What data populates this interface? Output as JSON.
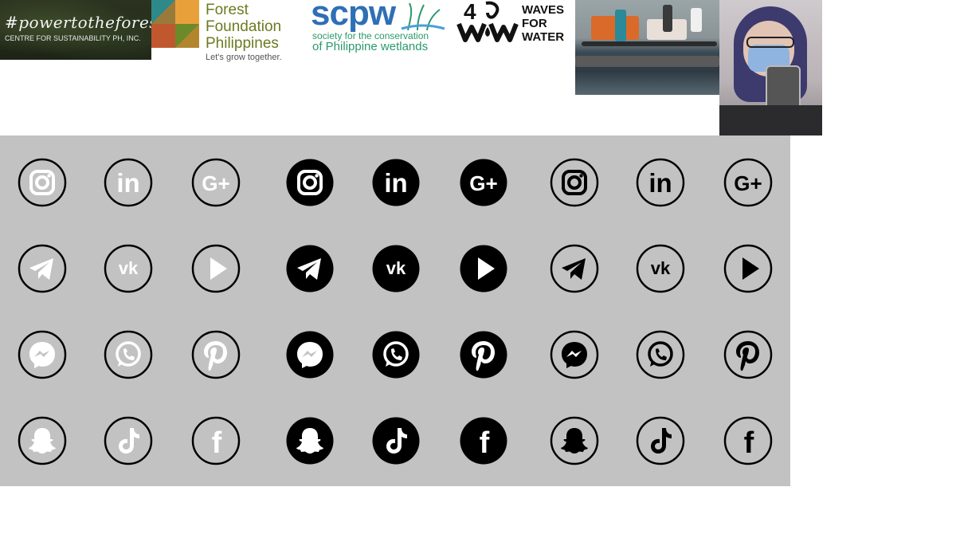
{
  "logos": {
    "cfs": {
      "tagline": "#powertotheforest",
      "org": "CENTRE FOR SUSTAINABILITY PH, INC."
    },
    "ffp": {
      "name_line1": "Forest",
      "name_line2": "Foundation",
      "name_line3": "Philippines",
      "slogan": "Let's grow together."
    },
    "scpw": {
      "abbr": "scpw",
      "line1": "society for the conservation",
      "line2": "of Philippine wetlands"
    },
    "wfw": {
      "mark": "4",
      "word1": "WAVES",
      "word2": "FOR",
      "word3": "WATER"
    }
  },
  "icon_grid": {
    "styles": [
      "white-outline",
      "black-filled",
      "black-outline"
    ],
    "colors": {
      "panel": "#c2c2c2",
      "white": "#ffffff",
      "black": "#000000"
    },
    "rows": [
      [
        "instagram-icon",
        "linkedin-icon",
        "google-plus-icon"
      ],
      [
        "telegram-icon",
        "vk-icon",
        "play-icon"
      ],
      [
        "messenger-icon",
        "whatsapp-icon",
        "pinterest-icon"
      ],
      [
        "snapchat-icon",
        "tiktok-icon",
        "facebook-icon"
      ]
    ],
    "glyph_text": {
      "linkedin": "in",
      "google_plus": "G+",
      "vk": "vk",
      "facebook": "f",
      "pinterest": "p"
    }
  }
}
